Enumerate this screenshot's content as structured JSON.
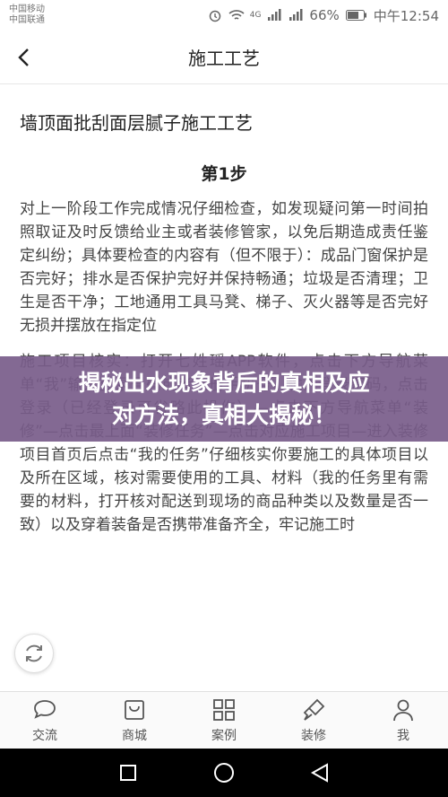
{
  "status": {
    "carrier1": "中国移动",
    "carrier2": "中国联通",
    "signal1": "4G",
    "battery": "66%",
    "time": "中午12:54"
  },
  "nav": {
    "title": "施工工艺"
  },
  "article": {
    "title": "墙顶面批刮面层腻子施工工艺",
    "step": "第1步",
    "paragraph1": "对上一阶段工作完成情况仔细检查，如发现疑问第一时间拍照取证及时反馈给业主或者装修管家，以免后期造成责任鉴定纠纷；具体要检查的内容有（但不限于）：成品门窗保护是否完好；排水是否保护完好并保持畅通；垃圾是否清理；卫生是否干净；工地通用工具马凳、梯子、灭火器等是否完好无损并摆放在指定位",
    "paragraph2": "施工项目核实：打开七姓瑶APP软件，点击下方导航菜单“我”输入登录号码或者注册手机号，输入登录密码，点击登录（已经登录可省略此操作）—点击下方导航菜单“装修”—点击最上面“装修任务”—点击对应施工项目—进入装修项目首页后点击“我的任务”仔细核实你要施工的具体项目以及所在区域，核对需要使用的工具、材料（我的任务里有需要的材料，打开核对配送到现场的商品种类以及数量是否一致）以及穿着装备是否携带准备齐全，牢记施工时"
  },
  "banner": {
    "line1": "揭秘出水现象背后的真相及应",
    "line2": "对方法，真相大揭秘！"
  },
  "tabs": [
    {
      "label": "交流",
      "icon": "chat-icon"
    },
    {
      "label": "商城",
      "icon": "shopping-bag-icon"
    },
    {
      "label": "案例",
      "icon": "grid-icon"
    },
    {
      "label": "装修",
      "icon": "brush-icon"
    },
    {
      "label": "我",
      "icon": "user-icon"
    }
  ]
}
